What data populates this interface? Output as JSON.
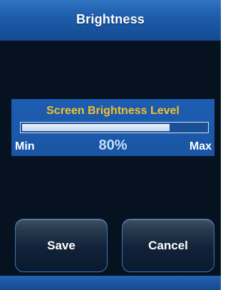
{
  "header": {
    "title": "Brightness"
  },
  "brightness_panel": {
    "heading": "Screen Brightness Level",
    "level_percent": 80,
    "value_label": "80%",
    "min_label": "Min",
    "max_label": "Max"
  },
  "actions": {
    "save_label": "Save",
    "cancel_label": "Cancel"
  },
  "colors": {
    "accent_blue": "#1c5aa8",
    "heading_yellow": "#f4c02a",
    "background": "#06121f"
  }
}
